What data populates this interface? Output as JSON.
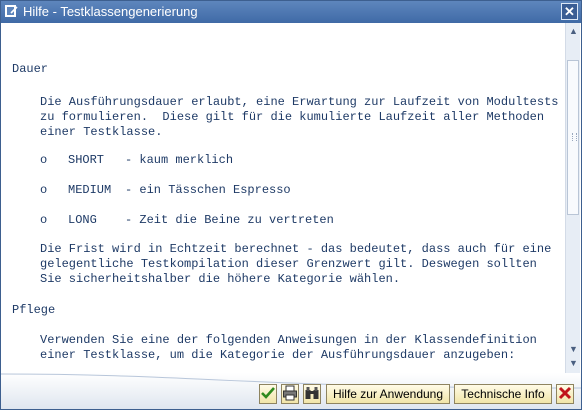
{
  "window": {
    "title": "Hilfe - Testklassengenerierung"
  },
  "content": {
    "dauer_heading": "Dauer",
    "intro_lines": [
      "Die Ausführungsdauer erlaubt, eine Erwartung zur Laufzeit von Modultests",
      "zu formulieren.  Diese gilt für die kumulierte Laufzeit aller Methoden",
      "einer Testklasse."
    ],
    "bullets": [
      {
        "marker": "o",
        "key": "SHORT",
        "text": "- kaum merklich"
      },
      {
        "marker": "o",
        "key": "MEDIUM",
        "text": "- ein Tässchen Espresso"
      },
      {
        "marker": "o",
        "key": "LONG",
        "text": "- Zeit die Beine zu vertreten"
      }
    ],
    "frist_lines": [
      "Die Frist wird in Echtzeit berechnet - das bedeutet, dass auch für eine",
      "gelegentliche Testkompilation dieser Grenzwert gilt. Deswegen sollten",
      "Sie sicherheitshalber die höhere Kategorie wählen."
    ],
    "pflege_heading": "Pflege",
    "pflege_lines": [
      "Verwenden Sie eine der folgenden Anweisungen in der Klassendefinition",
      "einer Testklasse, um die Kategorie der Ausführungsdauer anzugeben:"
    ]
  },
  "footer": {
    "help_button": "Hilfe zur Anwendung",
    "tech_info_button": "Technische Info"
  },
  "icons": {
    "confirm": "checkmark-icon",
    "print": "printer-icon",
    "find": "binoculars-icon",
    "cancel": "cancel-x-icon"
  },
  "colors": {
    "title_bar": "#4a73ac",
    "text": "#1e3a66",
    "button_bg": "#f6edbd",
    "confirm_green": "#2f8a1e",
    "cancel_red": "#c0141c"
  }
}
